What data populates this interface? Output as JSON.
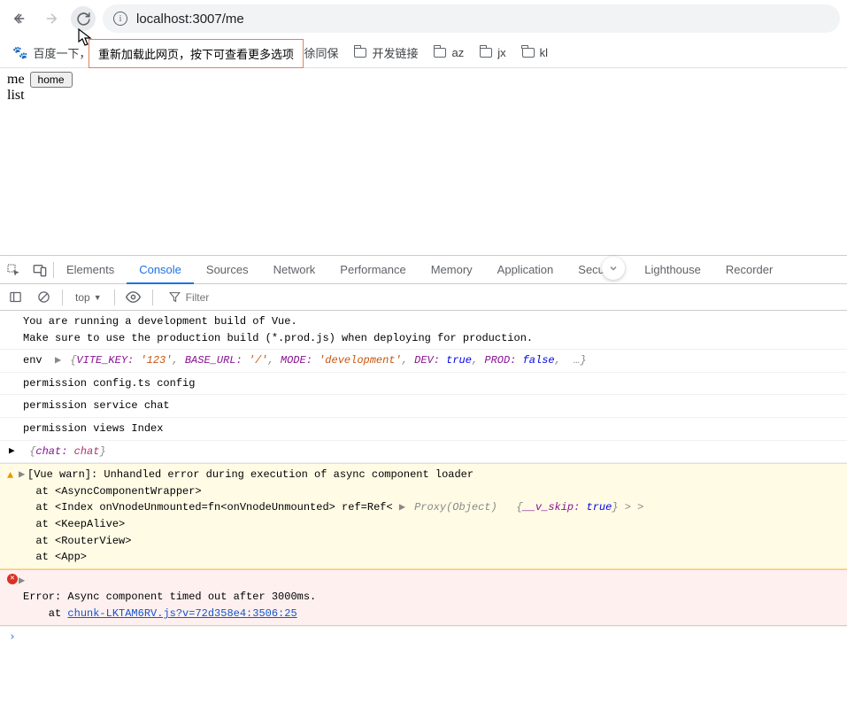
{
  "browser": {
    "url": "localhost:3007/me",
    "reload_tooltip": "重新加载此网页，按下可查看更多选项"
  },
  "bookmarks": {
    "items": [
      {
        "label": "百度一下，作",
        "type": "paw"
      },
      {
        "label": "徐同保",
        "type": "link"
      },
      {
        "label": "开发链接",
        "type": "folder"
      },
      {
        "label": "az",
        "type": "folder"
      },
      {
        "label": "jx",
        "type": "folder"
      },
      {
        "label": "kl",
        "type": "folder"
      }
    ]
  },
  "page": {
    "me": "me",
    "home_btn": "home",
    "list": "list"
  },
  "devtools": {
    "tabs": [
      "Elements",
      "Console",
      "Sources",
      "Network",
      "Performance",
      "Memory",
      "Application",
      "Security",
      "Lighthouse",
      "Recorder"
    ],
    "active_tab": "Console",
    "context": "top",
    "filter_placeholder": "Filter"
  },
  "console": {
    "r0_l1": "You are running a development build of Vue.",
    "r0_l2": "Make sure to use the production build (*.prod.js) when deploying for production.",
    "r1_label": "env",
    "r1_obj_open": "{",
    "r1_k1": "VITE_KEY:",
    "r1_v1": "'123'",
    "r1_k2": "BASE_URL:",
    "r1_v2": "'/'",
    "r1_k3": "MODE:",
    "r1_v3": "'development'",
    "r1_k4": "DEV:",
    "r1_v4": "true",
    "r1_k5": "PROD:",
    "r1_v5": "false",
    "r1_obj_close": ",  …}",
    "r2": "permission config.ts config",
    "r3": "permission service chat",
    "r4": "permission views Index",
    "r5_open": "{",
    "r5_k": "chat:",
    "r5_v": "chat",
    "r5_close": "}",
    "warn_l1": "[Vue warn]: Unhandled error during execution of async component loader ",
    "warn_l2": "  at <AsyncComponentWrapper>",
    "warn_l3_a": "  at <Index onVnodeUnmounted=fn<onVnodeUnmounted> ref=Ref< ",
    "warn_l3_proxy": "Proxy(Object)",
    "warn_l3_brace": "{",
    "warn_l3_skip_k": "__v_skip:",
    "warn_l3_skip_v": "true",
    "warn_l3_end": "} > >",
    "warn_l4": "  at <KeepAlive>",
    "warn_l5": "  at <RouterView>",
    "warn_l6": "  at <App>",
    "err_l1": "Error: Async component timed out after 3000ms.",
    "err_l2_pre": "    at ",
    "err_l2_link": "chunk-LKTAM6RV.js?v=72d358e4:3506:25"
  }
}
